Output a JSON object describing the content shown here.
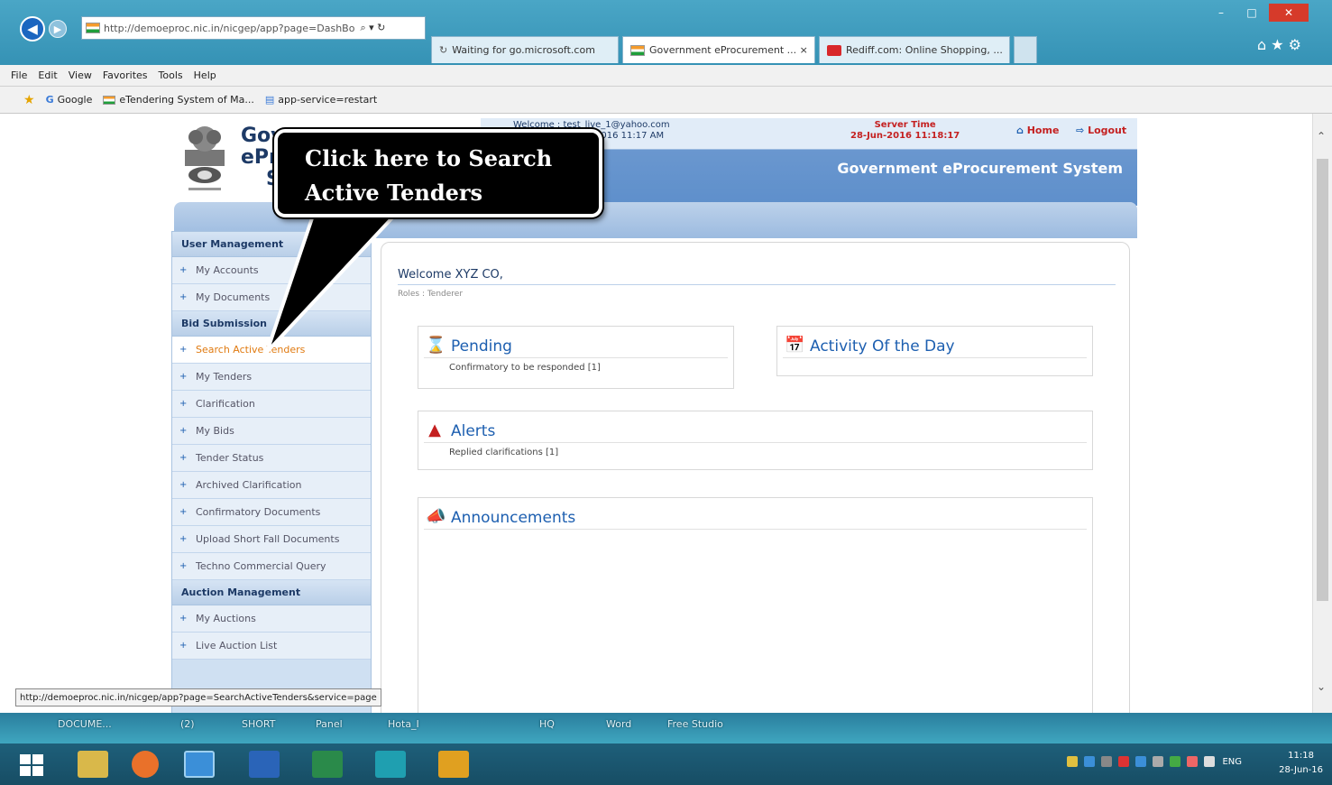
{
  "browser": {
    "address": "http://demoeproc.nic.in/nicgep/app?page=DashBo",
    "address_controls": "⌕ ▾ ↻",
    "tabs": [
      {
        "label": "Waiting for go.microsoft.com"
      },
      {
        "label": "Government eProcurement ... ×"
      },
      {
        "label": "Rediff.com: Online Shopping, ..."
      }
    ],
    "window_controls": {
      "minimize": "–",
      "maximize": "□",
      "close": "✕"
    },
    "toolbar_icons": "⌂ ★ ⚙",
    "menu": [
      "File",
      "Edit",
      "View",
      "Favorites",
      "Tools",
      "Help"
    ],
    "favorites": [
      "Google",
      "eTendering System of Ma...",
      "app-service=restart"
    ],
    "status_url": "http://demoeproc.nic.in/nicgep/app?page=SearchActiveTenders&service=page"
  },
  "portal": {
    "title_lines": [
      "Gov",
      "ePro",
      "S"
    ],
    "welcome_user_lines": [
      "Welcome : test_live_1@yahoo.com",
      "Last login: 28-Jun-2016 11:17 AM"
    ],
    "server_time_label": "Server Time",
    "server_time_value": "28-Jun-2016 11:18:17",
    "home_label": "Home",
    "logout_label": "Logout",
    "system_title": "Government eProcurement System"
  },
  "sidebar": {
    "sections": [
      {
        "title": "User Management",
        "items": [
          "My Accounts",
          "My Documents"
        ]
      },
      {
        "title": "Bid Submission",
        "items": [
          "Search Active Tenders",
          "My Tenders",
          "Clarification",
          "My Bids",
          "Tender Status",
          "Archived Clarification",
          "Confirmatory Documents",
          "Upload Short Fall Documents",
          "Techno Commercial Query"
        ]
      },
      {
        "title": "Auction Management",
        "items": [
          "My Auctions",
          "Live Auction List"
        ]
      }
    ],
    "plus_icon": "+"
  },
  "main": {
    "welcome": "Welcome XYZ CO,",
    "role": "Roles : Tenderer",
    "pending": {
      "title": "Pending",
      "line": "Confirmatory to be responded [1]"
    },
    "activity": {
      "title": "Activity Of the Day"
    },
    "alerts": {
      "title": "Alerts",
      "line": "Replied clarifications [1]"
    },
    "announcements": {
      "title": "Announcements"
    }
  },
  "callout": {
    "line1": "Click here to Search",
    "line2": "Active Tenders"
  },
  "desktop": {
    "labels": [
      "DOCUME...",
      "(2)",
      "SHORT",
      "Panel",
      "Hota_I",
      "HQ",
      "Word",
      "Free Studio"
    ]
  },
  "taskbar": {
    "lang": "ENG",
    "time": "11:18",
    "date": "28-Jun-16"
  },
  "colors": {
    "accent": "#1d5fb0",
    "highlight": "#e07a10",
    "callout_bg": "#000000",
    "alert_red": "#c42020"
  }
}
